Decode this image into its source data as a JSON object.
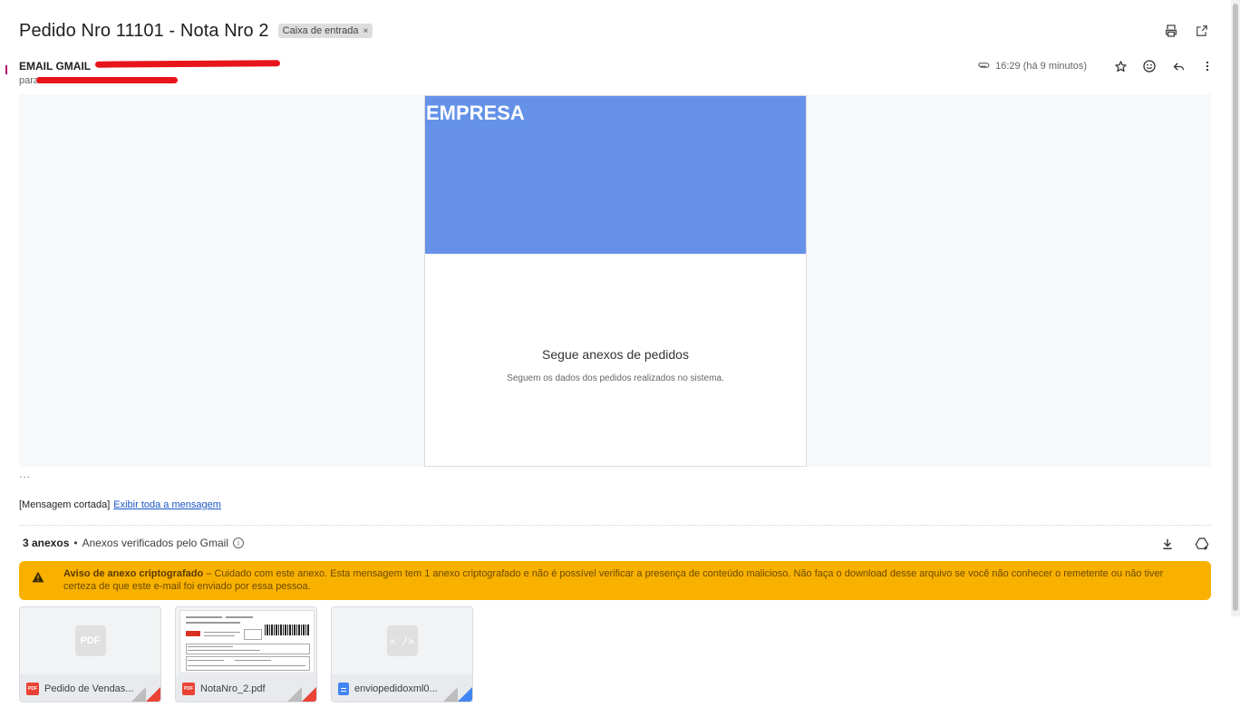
{
  "header": {
    "subject": "Pedido Nro 11101 - Nota Nro 2",
    "label_chip": "Caixa de entrada",
    "label_close": "×"
  },
  "icons": {
    "print": "print-icon",
    "open_new_window": "open-in-new-icon",
    "attachment": "paperclip-icon",
    "star": "star-icon",
    "emoji": "emoji-icon",
    "reply": "reply-icon",
    "more": "more-vert-icon",
    "download_all": "download-icon",
    "add_to_drive": "add-to-drive-icon",
    "warning": "warning-icon"
  },
  "sender": {
    "name": "EMAIL GMAIL",
    "to_label": "para",
    "timestamp": "16:29 (há 9 minutos)"
  },
  "email": {
    "banner_title": "EMPRESA",
    "banner_color": "#6592e8",
    "heading": "Segue anexos de pedidos",
    "subtext": "Seguem os dados dos pedidos realizados no sistema.",
    "ellipsis": "...",
    "clipped_text": "[Mensagem cortada]",
    "clipped_link": "Exibir toda a mensagem"
  },
  "attachments": {
    "count_label": "3 anexos",
    "separator": "•",
    "verified": "Anexos verificados pelo Gmail",
    "info_symbol": "i",
    "warning": {
      "color": "#f9b100",
      "title": "Aviso de anexo criptografado",
      "body": " – Cuidado com este anexo. Esta mensagem tem 1 anexo criptografado e não é possível verificar a presença de conteúdo malicioso. Não faça o download desse arquivo se você não conhecer o remetente ou não tiver certeza de que este e-mail foi enviado por essa pessoa."
    },
    "items": [
      {
        "name": "Pedido de Vendas...",
        "type_badge": "PDF",
        "placeholder": "PDF"
      },
      {
        "name": "NotaNro_2.pdf",
        "type_badge": "PDF"
      },
      {
        "name": "enviopedidoxml0...",
        "placeholder": "< />"
      }
    ]
  }
}
